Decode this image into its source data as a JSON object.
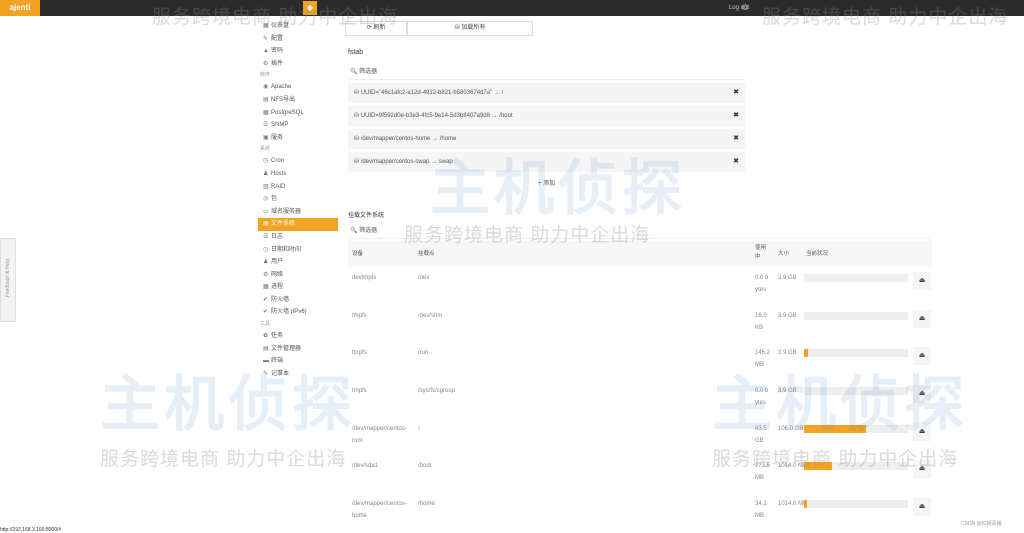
{
  "header": {
    "brand": "ajenti",
    "top_icon": "◆",
    "logout_label": "Log out",
    "power_icon": "⏻"
  },
  "sidebar": {
    "items": [
      {
        "icon": "▦",
        "label": "仪表盘"
      },
      {
        "icon": "✎",
        "label": "配置"
      },
      {
        "icon": "▲",
        "label": "密码"
      },
      {
        "icon": "⚙",
        "label": "插件"
      },
      {
        "group": "软件"
      },
      {
        "icon": "◉",
        "label": "Apache"
      },
      {
        "icon": "▤",
        "label": "NFS导出"
      },
      {
        "icon": "▦",
        "label": "PostgreSQL"
      },
      {
        "icon": "☰",
        "label": "SNMP"
      },
      {
        "icon": "▣",
        "label": "服务"
      },
      {
        "group": "系统"
      },
      {
        "icon": "◷",
        "label": "Cron"
      },
      {
        "icon": "♟",
        "label": "Hosts"
      },
      {
        "icon": "▥",
        "label": "RAID"
      },
      {
        "icon": "◎",
        "label": "包"
      },
      {
        "icon": "▭",
        "label": "域名服务器"
      },
      {
        "icon": "▤",
        "label": "文件系统",
        "active": true
      },
      {
        "icon": "☰",
        "label": "日志"
      },
      {
        "icon": "◷",
        "label": "日期和时间"
      },
      {
        "icon": "♟",
        "label": "用户"
      },
      {
        "icon": "⚙",
        "label": "网络"
      },
      {
        "icon": "▦",
        "label": "进程"
      },
      {
        "icon": "✔",
        "label": "防火墙"
      },
      {
        "icon": "✔",
        "label": "防火墙 (IPv6)"
      },
      {
        "group": "工具"
      },
      {
        "icon": "✿",
        "label": "任务"
      },
      {
        "icon": "▤",
        "label": "文件管理器"
      },
      {
        "icon": "▬",
        "label": "终端"
      },
      {
        "icon": "✎",
        "label": "记事本"
      }
    ]
  },
  "toolbar": {
    "refresh_label": "⟳ 刷新",
    "mount_all_label": "⛁ 加载所有"
  },
  "fstab": {
    "title": "fstab",
    "filter_label": "🔍 筛选器",
    "rows": [
      "⛁  UUID=\"46c1afc2-a12d-4912-b821-b5803674d7a\" → /",
      "⛁  UUID=9f592d0e-b3e3-4fc5-9e14-5d3b8407a9d8 → /boot",
      "⛁  /dev/mapper/centos-home → /home",
      "⛁  /dev/mapper/centos-swap → swap"
    ],
    "add_label": "+ 添加"
  },
  "mounted": {
    "title": "挂载文件系统",
    "filter_label": "🔍 筛选器",
    "headers": {
      "device": "设备",
      "mountpoint": "挂载点",
      "used": "使用中",
      "size": "大小",
      "status": "当前状况"
    },
    "rows": [
      {
        "device": "devtmpfs",
        "mount": "/dev",
        "used": "0.0 bytes",
        "size": "3.9 GB",
        "pct": 0
      },
      {
        "device": "tmpfs",
        "mount": "/dev/shm",
        "used": "16.0 KB",
        "size": "3.9 GB",
        "pct": 0
      },
      {
        "device": "tmpfs",
        "mount": "/run",
        "used": "146.2 MB",
        "size": "3.9 GB",
        "pct": 4
      },
      {
        "device": "tmpfs",
        "mount": "/sys/fs/cgroup",
        "used": "0.0 bytes",
        "size": "3.9 GB",
        "pct": 0
      },
      {
        "device": "/dev/mapper/centos-root",
        "mount": "/",
        "used": "63.5 GB",
        "size": "106.0 GB",
        "pct": 60
      },
      {
        "device": "/dev/sda1",
        "mount": "/boot",
        "used": "273.5 MB",
        "size": "1014.0 MB",
        "pct": 27
      },
      {
        "device": "/dev/mapper/centos-home",
        "mount": "/home",
        "used": "34.1 MB",
        "size": "1014.0 MB",
        "pct": 3
      }
    ]
  },
  "statusbar": "http://192.168.3.166:8000/#",
  "credit": "CSDN @红帽青缘",
  "watermark": {
    "text": "服务跨境电商  助力中企出海",
    "logo": "主机侦探"
  }
}
